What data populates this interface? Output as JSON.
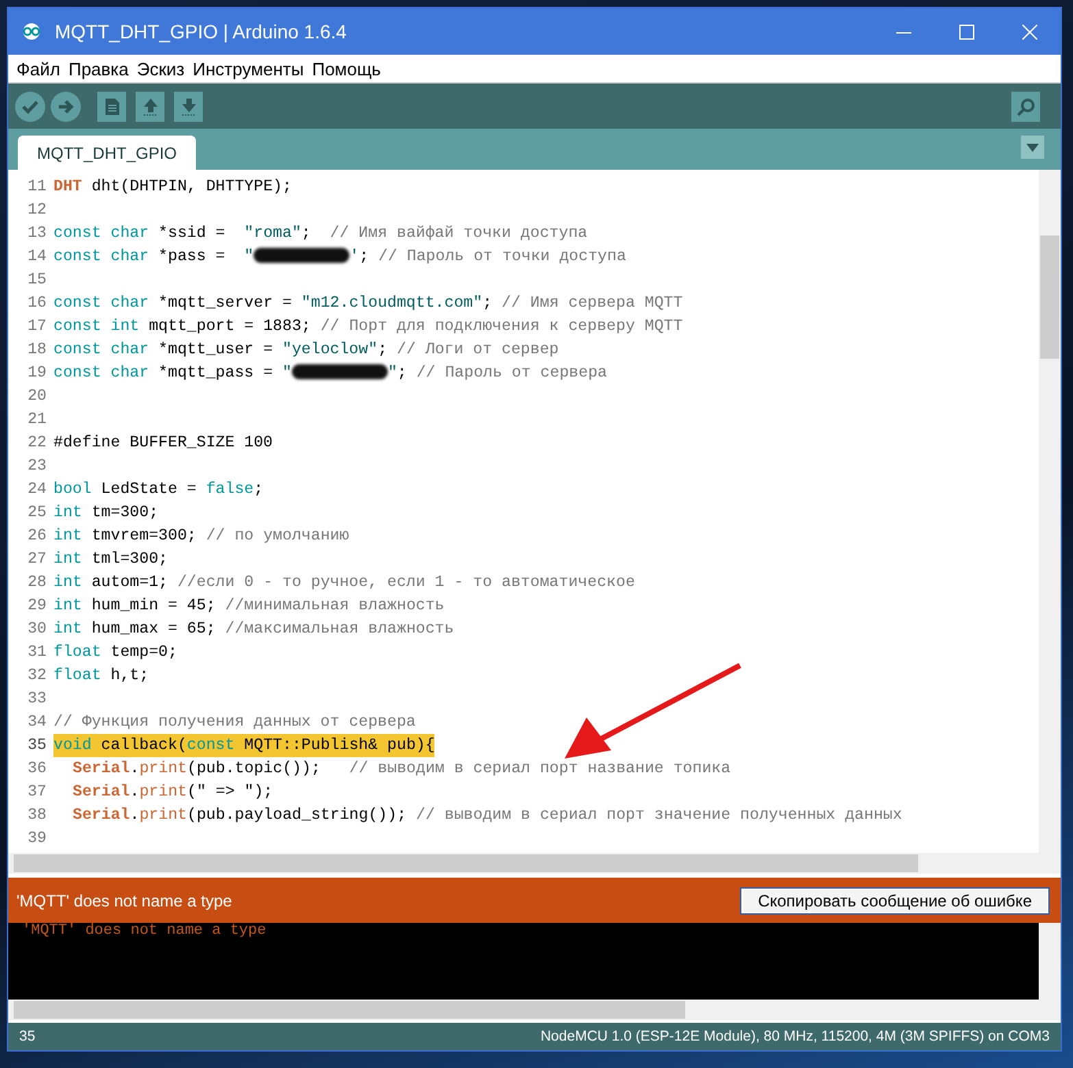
{
  "window": {
    "title": "MQTT_DHT_GPIO | Arduino 1.6.4"
  },
  "menu": [
    "Файл",
    "Правка",
    "Эскиз",
    "Инструменты",
    "Помощь"
  ],
  "tabs": [
    {
      "label": "MQTT_DHT_GPIO",
      "selected": true
    }
  ],
  "editor": {
    "lines": [
      {
        "number": "11",
        "highlighted": false,
        "tokens": [
          {
            "kind": "type",
            "text": "DHT"
          },
          {
            "kind": "plain",
            "text": " dht(DHTPIN, DHTTYPE);"
          }
        ]
      },
      {
        "number": "12",
        "highlighted": false
      },
      {
        "number": "13",
        "highlighted": false,
        "tokens": [
          {
            "kind": "keyword",
            "text": "const char"
          },
          {
            "kind": "plain",
            "text": " *ssid =  "
          },
          {
            "kind": "string",
            "text": "\"roma\""
          },
          {
            "kind": "plain",
            "text": ";  "
          },
          {
            "kind": "comment",
            "text": "// Имя вайфай точки доступа"
          }
        ]
      },
      {
        "number": "14",
        "highlighted": false,
        "tokens": [
          {
            "kind": "keyword",
            "text": "const char"
          },
          {
            "kind": "plain",
            "text": " *pass =  "
          },
          {
            "kind": "string",
            "text": "\""
          },
          {
            "kind": "redacted"
          },
          {
            "kind": "string",
            "text": "'"
          },
          {
            "kind": "plain",
            "text": "; "
          },
          {
            "kind": "comment",
            "text": "// Пароль от точки доступа"
          }
        ]
      },
      {
        "number": "15",
        "highlighted": false
      },
      {
        "number": "16",
        "highlighted": false,
        "tokens": [
          {
            "kind": "keyword",
            "text": "const char"
          },
          {
            "kind": "plain",
            "text": " *mqtt_server = "
          },
          {
            "kind": "string",
            "text": "\"m12.cloudmqtt.com\""
          },
          {
            "kind": "plain",
            "text": "; "
          },
          {
            "kind": "comment",
            "text": "// Имя сервера MQTT"
          }
        ]
      },
      {
        "number": "17",
        "highlighted": false,
        "tokens": [
          {
            "kind": "keyword",
            "text": "const int"
          },
          {
            "kind": "plain",
            "text": " mqtt_port = 1883; "
          },
          {
            "kind": "comment",
            "text": "// Порт для подключения к серверу MQTT"
          }
        ]
      },
      {
        "number": "18",
        "highlighted": false,
        "tokens": [
          {
            "kind": "keyword",
            "text": "const char"
          },
          {
            "kind": "plain",
            "text": " *mqtt_user = "
          },
          {
            "kind": "string",
            "text": "\"yeloclow\""
          },
          {
            "kind": "plain",
            "text": "; "
          },
          {
            "kind": "comment",
            "text": "// Логи от сервер"
          }
        ]
      },
      {
        "number": "19",
        "highlighted": false,
        "tokens": [
          {
            "kind": "keyword",
            "text": "const char"
          },
          {
            "kind": "plain",
            "text": " *mqtt_pass = "
          },
          {
            "kind": "string",
            "text": "\""
          },
          {
            "kind": "redacted"
          },
          {
            "kind": "string",
            "text": "\""
          },
          {
            "kind": "plain",
            "text": "; "
          },
          {
            "kind": "comment",
            "text": "// Пароль от сервера"
          }
        ]
      },
      {
        "number": "20",
        "highlighted": false
      },
      {
        "number": "21",
        "highlighted": false
      },
      {
        "number": "22",
        "highlighted": false,
        "tokens": [
          {
            "kind": "plain",
            "text": "#define BUFFER_SIZE 100"
          }
        ]
      },
      {
        "number": "23",
        "highlighted": false
      },
      {
        "number": "24",
        "highlighted": false,
        "tokens": [
          {
            "kind": "keyword",
            "text": "bool"
          },
          {
            "kind": "plain",
            "text": " LedState = "
          },
          {
            "kind": "keyword",
            "text": "false"
          },
          {
            "kind": "plain",
            "text": ";"
          }
        ]
      },
      {
        "number": "25",
        "highlighted": false,
        "tokens": [
          {
            "kind": "keyword",
            "text": "int"
          },
          {
            "kind": "plain",
            "text": " tm=300;"
          }
        ]
      },
      {
        "number": "26",
        "highlighted": false,
        "tokens": [
          {
            "kind": "keyword",
            "text": "int"
          },
          {
            "kind": "plain",
            "text": " tmvrem=300; "
          },
          {
            "kind": "comment",
            "text": "// по умолчанию"
          }
        ]
      },
      {
        "number": "27",
        "highlighted": false,
        "tokens": [
          {
            "kind": "keyword",
            "text": "int"
          },
          {
            "kind": "plain",
            "text": " tml=300;"
          }
        ]
      },
      {
        "number": "28",
        "highlighted": false,
        "tokens": [
          {
            "kind": "keyword",
            "text": "int"
          },
          {
            "kind": "plain",
            "text": " autom=1; "
          },
          {
            "kind": "comment",
            "text": "//если 0 - то ручное, если 1 - то автоматическое"
          }
        ]
      },
      {
        "number": "29",
        "highlighted": false,
        "tokens": [
          {
            "kind": "keyword",
            "text": "int"
          },
          {
            "kind": "plain",
            "text": " hum_min = 45; "
          },
          {
            "kind": "comment",
            "text": "//минимальная влажность"
          }
        ]
      },
      {
        "number": "30",
        "highlighted": false,
        "tokens": [
          {
            "kind": "keyword",
            "text": "int"
          },
          {
            "kind": "plain",
            "text": " hum_max = 65; "
          },
          {
            "kind": "comment",
            "text": "//максимальная влажность"
          }
        ]
      },
      {
        "number": "31",
        "highlighted": false,
        "tokens": [
          {
            "kind": "keyword",
            "text": "float"
          },
          {
            "kind": "plain",
            "text": " temp=0;"
          }
        ]
      },
      {
        "number": "32",
        "highlighted": false,
        "tokens": [
          {
            "kind": "keyword",
            "text": "float"
          },
          {
            "kind": "plain",
            "text": " h,t;"
          }
        ]
      },
      {
        "number": "33",
        "highlighted": false
      },
      {
        "number": "34",
        "highlighted": false,
        "tokens": [
          {
            "kind": "comment",
            "text": "// Функция получения данных от сервера"
          }
        ]
      },
      {
        "number": "35",
        "highlighted": true,
        "tokens": [
          {
            "kind": "keyword",
            "text": "void"
          },
          {
            "kind": "plain",
            "text": " callback("
          },
          {
            "kind": "keyword",
            "text": "const"
          },
          {
            "kind": "plain",
            "text": " MQTT::Publish& pub){"
          }
        ]
      },
      {
        "number": "36",
        "highlighted": false,
        "indented": true,
        "tokens": [
          {
            "kind": "type",
            "text": "Serial"
          },
          {
            "kind": "plain",
            "text": "."
          },
          {
            "kind": "function",
            "text": "print"
          },
          {
            "kind": "plain",
            "text": "(pub.topic());   "
          },
          {
            "kind": "comment",
            "text": "// выводим в сериал порт название топика"
          }
        ]
      },
      {
        "number": "37",
        "highlighted": false,
        "indented": true,
        "tokens": [
          {
            "kind": "type",
            "text": "Serial"
          },
          {
            "kind": "plain",
            "text": "."
          },
          {
            "kind": "function",
            "text": "print"
          },
          {
            "kind": "plain",
            "text": "(\" => \");"
          }
        ]
      },
      {
        "number": "38",
        "highlighted": false,
        "indented": true,
        "tokens": [
          {
            "kind": "type",
            "text": "Serial"
          },
          {
            "kind": "plain",
            "text": "."
          },
          {
            "kind": "function",
            "text": "print"
          },
          {
            "kind": "plain",
            "text": "(pub.payload_string()); "
          },
          {
            "kind": "comment",
            "text": "// выводим в сериал порт значение полученных данных"
          }
        ]
      },
      {
        "number": "39",
        "highlighted": false
      }
    ]
  },
  "error_bar": {
    "message": "'MQTT' does not name a type",
    "button": "Скопировать сообщение об ошибке"
  },
  "console": {
    "lines": [
      "'MQTT' does not name a type"
    ]
  },
  "status_bar": {
    "line": "35",
    "board": "NodeMCU 1.0 (ESP-12E Module), 80 MHz, 115200, 4M (3M SPIFFS) on COM3"
  }
}
